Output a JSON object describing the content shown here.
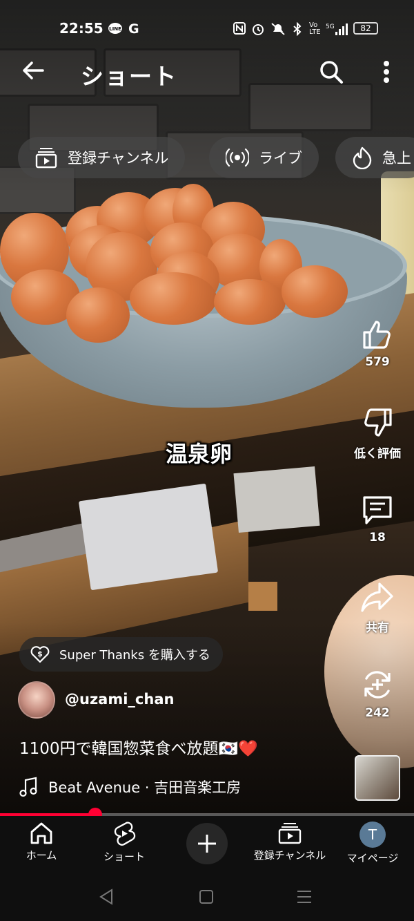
{
  "status_bar": {
    "time": "22:55",
    "notif_icons": [
      "line-icon",
      "google-icon"
    ],
    "system_icons": [
      "nfc-icon",
      "alarm-icon",
      "mute-icon",
      "bluetooth-icon",
      "volte-icon",
      "signal-5g-icon"
    ],
    "battery": "82"
  },
  "top_bar": {
    "title": "ショート",
    "icons": [
      "back-arrow-icon",
      "search-icon",
      "more-vert-icon"
    ]
  },
  "chips": [
    {
      "label": "登録チャンネル",
      "icon": "subscriptions-icon"
    },
    {
      "label": "ライブ",
      "icon": "live-icon"
    },
    {
      "label": "急上",
      "icon": "trending-icon"
    }
  ],
  "video": {
    "caption": "温泉卵"
  },
  "actions": {
    "like": {
      "label": "579",
      "icon": "thumb-up-icon"
    },
    "dislike": {
      "label": "低く評価",
      "icon": "thumb-down-icon"
    },
    "comments": {
      "label": "18",
      "icon": "comment-icon"
    },
    "share": {
      "label": "共有",
      "icon": "share-icon"
    },
    "remix": {
      "label": "242",
      "icon": "remix-icon"
    }
  },
  "super_thanks": {
    "label": "Super Thanks を購入する",
    "icon": "super-thanks-icon"
  },
  "channel": {
    "handle": "@uzami_chan"
  },
  "description": "1100円で韓国惣菜食べ放題🇰🇷❤️",
  "music": {
    "label": "Beat Avenue · 吉田音楽工房",
    "icon": "music-note-icon"
  },
  "progress": {
    "fraction": 0.23
  },
  "bottom_nav": [
    {
      "label": "ホーム",
      "icon": "home-icon"
    },
    {
      "label": "ショート",
      "icon": "shorts-icon"
    },
    {
      "label": "",
      "icon": "create-plus-icon"
    },
    {
      "label": "登録チャンネル",
      "icon": "subscriptions-icon"
    },
    {
      "label": "マイページ",
      "icon": "avatar-icon",
      "avatar_letter": "T"
    }
  ],
  "system_nav": [
    "back-triangle-icon",
    "home-square-icon",
    "recents-menu-icon"
  ],
  "colors": {
    "accent_red": "#ff0033",
    "nav_bg": "#0f0f0f",
    "chip_bg": "#464646"
  }
}
